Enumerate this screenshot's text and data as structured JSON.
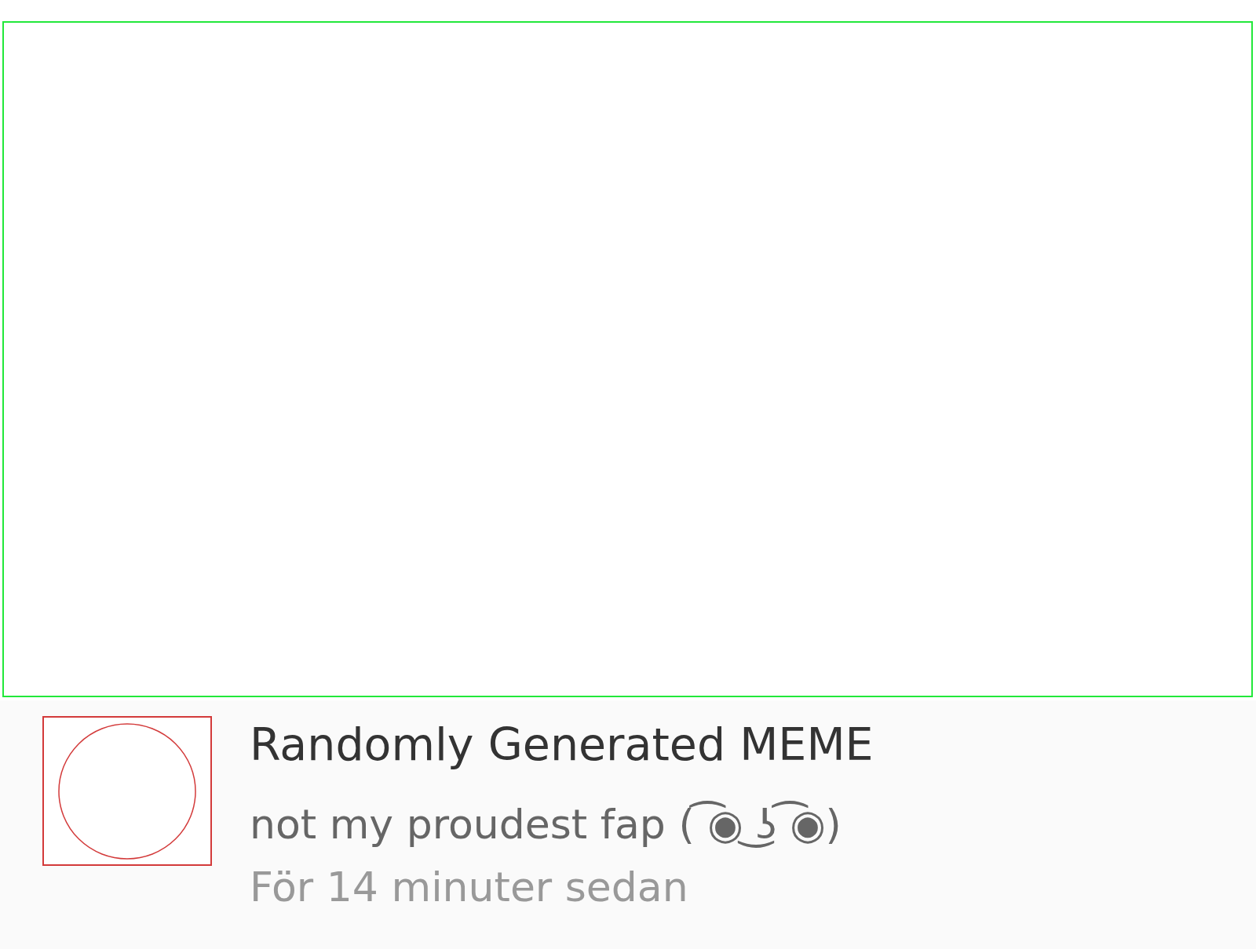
{
  "notification": {
    "title": "Randomly Generated MEME",
    "message": "not my proudest fap ( ͡◉ ͜ʖ ͡◉)",
    "time": "För 14 minuter sedan"
  }
}
